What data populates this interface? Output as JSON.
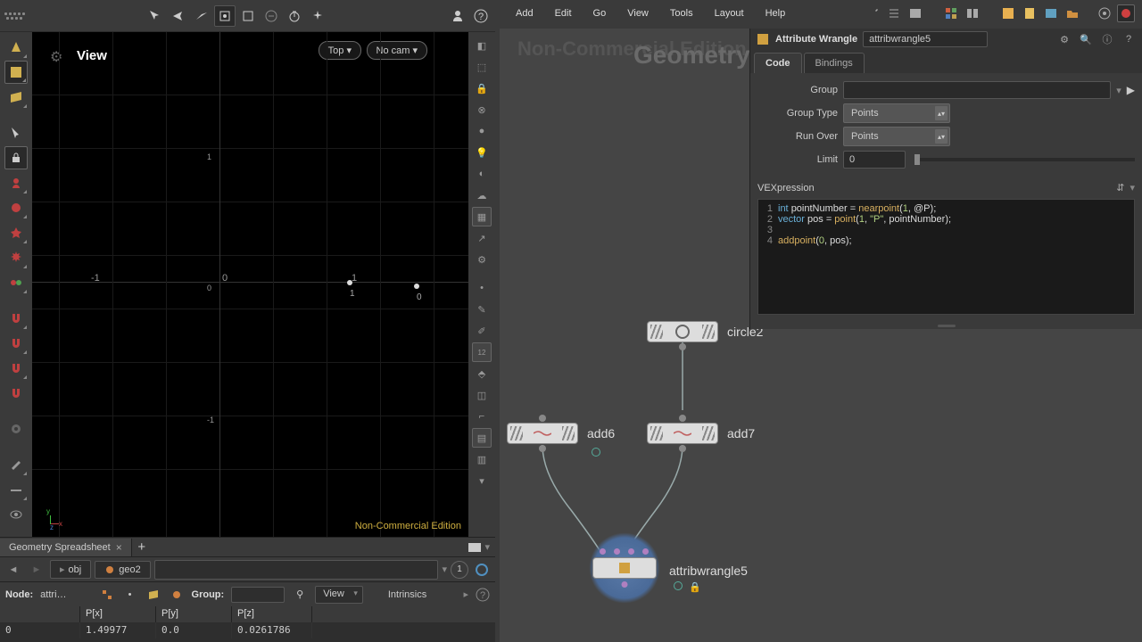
{
  "menu": {
    "items": [
      "Add",
      "Edit",
      "Go",
      "View",
      "Tools",
      "Layout",
      "Help"
    ]
  },
  "viewport": {
    "label": "View",
    "pill_top": "Top ▾",
    "pill_cam": "No cam ▾",
    "watermark": "Non-Commercial Edition",
    "axis": {
      "neg1": "-1",
      "zero": "0",
      "one": "1"
    },
    "points": [
      {
        "num": "1"
      },
      {
        "num": "0"
      }
    ]
  },
  "spreadsheet": {
    "tab": "Geometry Spreadsheet",
    "path": {
      "obj": "obj",
      "geo": "geo2",
      "proc": "1"
    },
    "nodebar": {
      "label": "Node:",
      "node": "attri…",
      "group": "Group:",
      "view": "View",
      "intr": "Intrinsics"
    },
    "cols": [
      "",
      "P[x]",
      "P[y]",
      "P[z]"
    ],
    "rows": [
      [
        "0",
        "1.49977",
        "0.0",
        "0.0261786"
      ]
    ]
  },
  "network": {
    "watermark1": "Non-Commercial Edition",
    "watermark2": "Geometry",
    "nodes": {
      "circle": "circle2",
      "add6": "add6",
      "add7": "add7",
      "wrangle": "attribwrangle5"
    }
  },
  "params": {
    "title": "Attribute Wrangle",
    "name": "attribwrangle5",
    "tabs": [
      "Code",
      "Bindings"
    ],
    "group": {
      "label": "Group",
      "value": ""
    },
    "gtype": {
      "label": "Group Type",
      "value": "Points"
    },
    "runover": {
      "label": "Run Over",
      "value": "Points"
    },
    "limit": {
      "label": "Limit",
      "value": "0"
    },
    "vexlabel": "VEXpression",
    "code": [
      {
        "n": "1",
        "tokens": [
          [
            "kw",
            "int "
          ],
          [
            "id",
            "pointNumber "
          ],
          [
            "op",
            "= "
          ],
          [
            "fn",
            "nearpoint"
          ],
          [
            "op",
            "("
          ],
          [
            "num",
            "1"
          ],
          [
            "op",
            ", "
          ],
          [
            "id",
            "@P"
          ],
          [
            "op",
            ");"
          ]
        ]
      },
      {
        "n": "2",
        "tokens": [
          [
            "kw",
            "vector "
          ],
          [
            "id",
            "pos "
          ],
          [
            "op",
            "= "
          ],
          [
            "fn",
            "point"
          ],
          [
            "op",
            "("
          ],
          [
            "num",
            "1"
          ],
          [
            "op",
            ", "
          ],
          [
            "str",
            "\"P\""
          ],
          [
            "op",
            ", pointNumber);"
          ]
        ]
      },
      {
        "n": "3",
        "tokens": []
      },
      {
        "n": "4",
        "tokens": [
          [
            "fn",
            "addpoint"
          ],
          [
            "op",
            "("
          ],
          [
            "num",
            "0"
          ],
          [
            "op",
            ", pos);"
          ]
        ]
      }
    ]
  }
}
